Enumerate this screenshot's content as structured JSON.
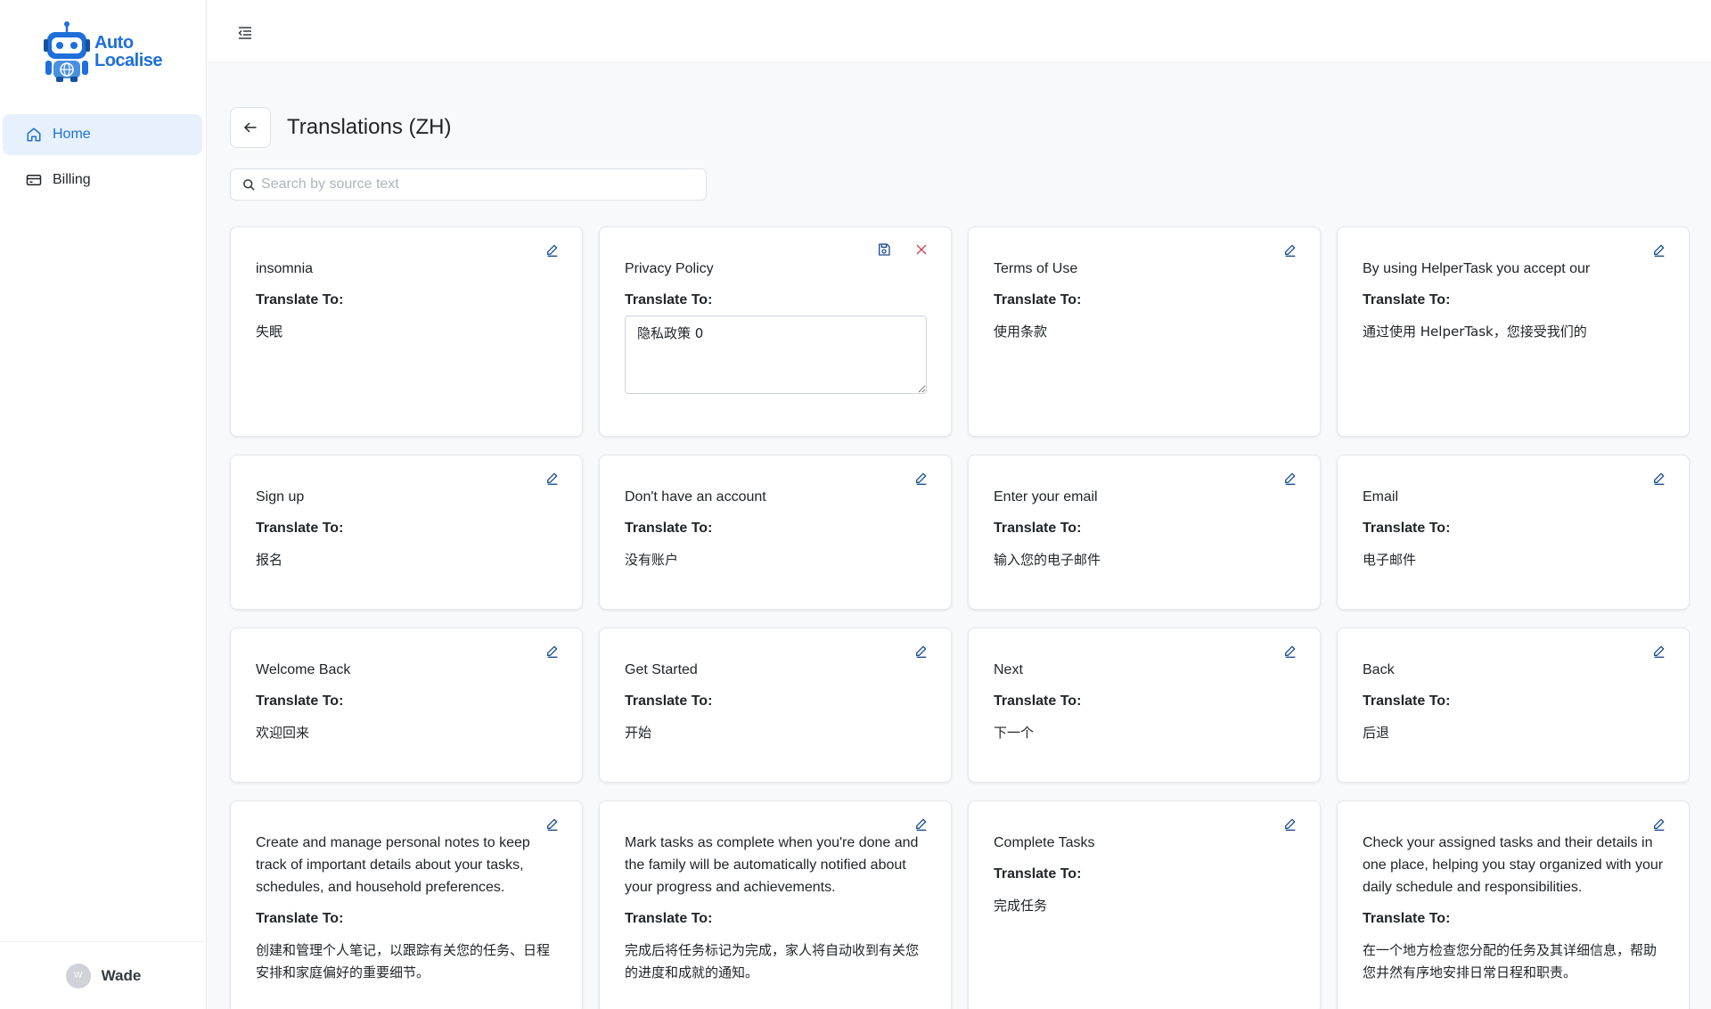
{
  "app": {
    "logo_line1": "Auto",
    "logo_line2": "Localise",
    "accent_color": "#1e6fd9"
  },
  "sidebar": {
    "items": [
      {
        "label": "Home",
        "icon": "home-icon",
        "active": true
      },
      {
        "label": "Billing",
        "icon": "credit-card-icon",
        "active": false
      }
    ],
    "user": {
      "initial": "W",
      "name": "Wade"
    }
  },
  "header": {
    "title": "Translations (ZH)"
  },
  "search": {
    "placeholder": "Search by source text"
  },
  "translate_label": "Translate To:",
  "cards": [
    {
      "source": "insomnia",
      "target": "失眠"
    },
    {
      "source": "Privacy Policy",
      "target": "隐私政策 0",
      "editing": true
    },
    {
      "source": "Terms of Use",
      "target": "使用条款"
    },
    {
      "source": "By using HelperTask you accept our",
      "target": "通过使用 HelperTask，您接受我们的"
    },
    {
      "source": "Sign up",
      "target": "报名"
    },
    {
      "source": "Don't have an account",
      "target": "没有账户"
    },
    {
      "source": "Enter your email",
      "target": "输入您的电子邮件"
    },
    {
      "source": "Email",
      "target": "电子邮件"
    },
    {
      "source": "Welcome Back",
      "target": "欢迎回来"
    },
    {
      "source": "Get Started",
      "target": "开始"
    },
    {
      "source": "Next",
      "target": "下一个"
    },
    {
      "source": "Back",
      "target": "后退"
    },
    {
      "source": "Create and manage personal notes to keep track of important details about your tasks, schedules, and household preferences.",
      "target": "创建和管理个人笔记，以跟踪有关您的任务、日程安排和家庭偏好的重要细节。"
    },
    {
      "source": "Mark tasks as complete when you're done and the family will be automatically notified about your progress and achievements.",
      "target": "完成后将任务标记为完成，家人将自动收到有关您的进度和成就的通知。"
    },
    {
      "source": "Complete Tasks",
      "target": "完成任务"
    },
    {
      "source": "Check your assigned tasks and their details in one place, helping you stay organized with your daily schedule and responsibilities.",
      "target": "在一个地方检查您分配的任务及其详细信息，帮助您井然有序地安排日常日程和职责。"
    }
  ]
}
